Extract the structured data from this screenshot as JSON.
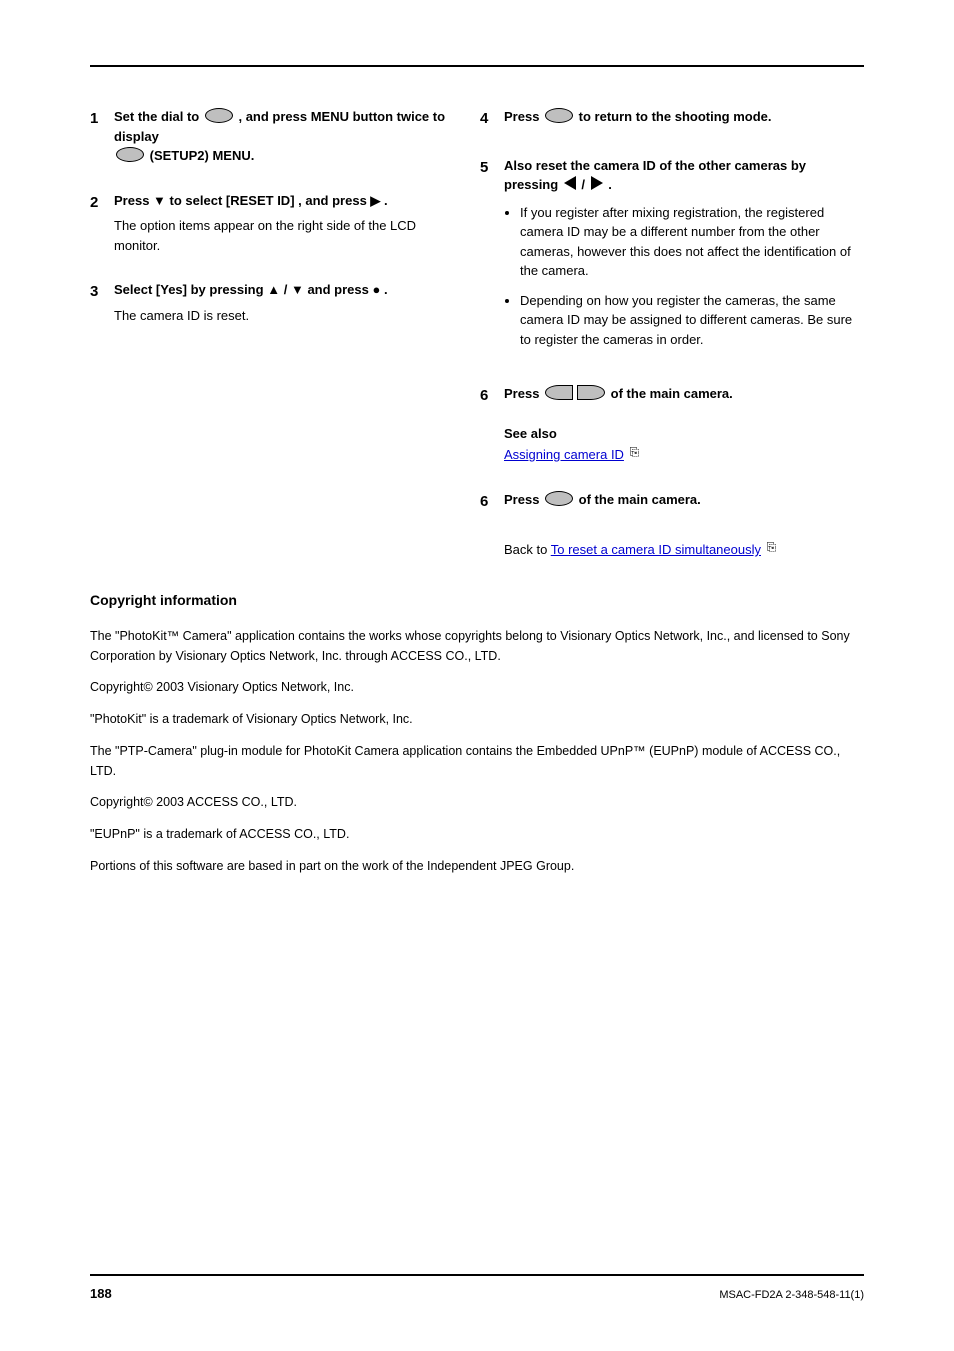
{
  "left": {
    "step1": {
      "num": "1",
      "line1a": "Set the dial to ",
      "line1b": ", and press MENU button twice to display ",
      "line1c": " (SETUP2) MENU.",
      "icon_set_name": "set-icon",
      "icon_spanner_name": "spanner-icon"
    },
    "step2": {
      "num": "2",
      "line1a": "Press ",
      "line1b": " to select ",
      "line1c": ", and press ",
      "line1d": ".",
      "explain": "The option items appear on the right side of the LCD monitor.",
      "icon_down_name": "down-triangle-icon",
      "reset_label": "[RESET ID]",
      "icon_right_name": "right-triangle-icon"
    },
    "step3": {
      "num": "3",
      "line1a": "Select [Yes] by pressing ",
      "line1b": "/",
      "line1c": " and press ",
      "line1d": ".",
      "explain": "The camera ID is reset.",
      "icon_up_name": "up-triangle-icon",
      "icon_down_name": "down-triangle-icon",
      "icon_ok_name": "ok-button-icon"
    }
  },
  "right": {
    "step4": {
      "num": "4",
      "line1a": "Press ",
      "line1b": " to return to the shooting mode.",
      "icon_name": "shooting-mode-icon"
    },
    "step5": {
      "num": "5",
      "line1a": "Also reset the camera ID of the other cameras by pressing ",
      "line1b": "/",
      "line1c": ".",
      "notes": [
        "If you register after mixing registration, the registered camera ID may be a different number from the other cameras, however this does not affect the identification of the camera.",
        "Depending on how you register the cameras, the same camera ID may be assigned to different cameras. Be sure to register the cameras in order."
      ],
      "icon_left_name": "left-half-pill-icon",
      "icon_right_name": "right-half-pill-icon"
    },
    "step6": {
      "num": "6",
      "line1a": "Press ",
      "line1b": " of the main camera.",
      "icon_name": "ok-button-icon"
    },
    "see_also_label": "See also",
    "see_also_link_text": "Assigning camera ID",
    "indented_note_prefix": "Back to ",
    "indented_note_link": "To reset a camera ID simultaneously"
  },
  "copyright": {
    "heading": "Copyright information",
    "p1": "The \"PhotoKit™ Camera\" application contains the works whose copyrights belong to Visionary Optics Network, Inc., and licensed to Sony Corporation by Visionary Optics Network, Inc. through ACCESS CO., LTD.",
    "p2": "Copyright© 2003 Visionary Optics Network, Inc.",
    "p3": "\"PhotoKit\" is a trademark of Visionary Optics Network, Inc.",
    "p4": "The \"PTP-Camera\" plug-in module for PhotoKit Camera application contains the Embedded UPnP™ (EUPnP) module of ACCESS CO., LTD.",
    "p5": "Copyright© 2003 ACCESS CO., LTD.",
    "p6": "\"EUPnP\" is a trademark of ACCESS CO., LTD.",
    "p7": "Portions of this software are based in part on the work of the Independent JPEG Group."
  },
  "footer": {
    "page": "188",
    "right": "MSAC-FD2A  2-348-548-11(1)"
  }
}
